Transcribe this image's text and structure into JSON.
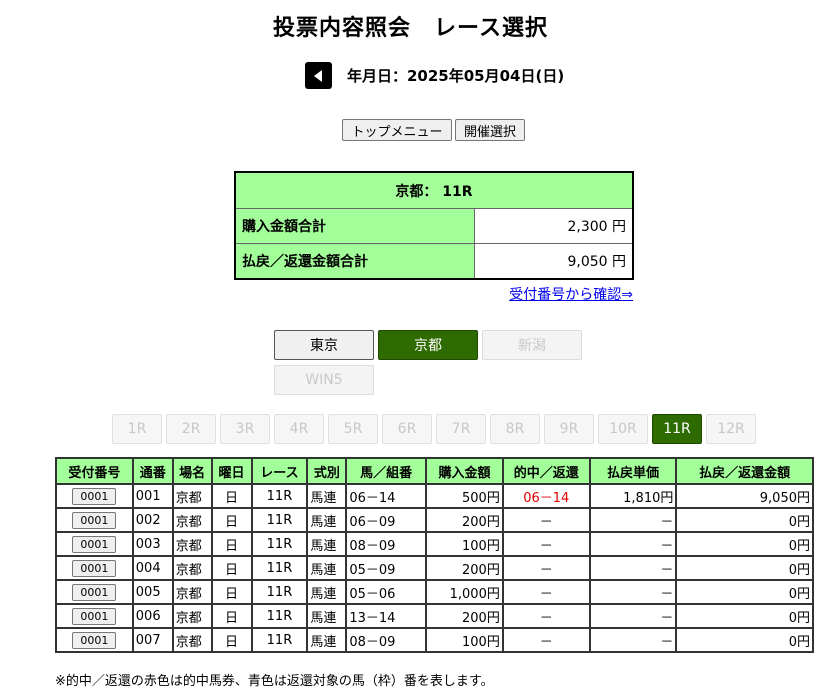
{
  "title": "投票内容照会　レース選択",
  "date_label": "年月日：2025年05月04日(日)",
  "buttons": {
    "top_menu": "トップメニュー",
    "kaisai": "開催選択"
  },
  "summary": {
    "header": "京都： 11R",
    "purchase_label": "購入金額合計",
    "purchase_value": "2,300 円",
    "refund_label": "払戻／返還金額合計",
    "refund_value": "9,050 円"
  },
  "confirm_link": "受付番号から確認⇒",
  "venues": [
    {
      "label": "東京",
      "state": "normal"
    },
    {
      "label": "京都",
      "state": "active"
    },
    {
      "label": "新潟",
      "state": "disabled"
    },
    {
      "label": "WIN5",
      "state": "disabled"
    }
  ],
  "races": [
    "1R",
    "2R",
    "3R",
    "4R",
    "5R",
    "6R",
    "7R",
    "8R",
    "9R",
    "10R",
    "11R",
    "12R"
  ],
  "active_race": "11R",
  "table": {
    "headers": [
      "受付番号",
      "通番",
      "場名",
      "曜日",
      "レース",
      "式別",
      "馬／組番",
      "購入金額",
      "的中／返還",
      "払戻単価",
      "払戻／返還金額"
    ],
    "rows": [
      [
        "0001",
        "001",
        "京都",
        "日",
        "11R",
        "馬連",
        "06－14",
        "500円",
        "06－14",
        "1,810円",
        "9,050円"
      ],
      [
        "0001",
        "002",
        "京都",
        "日",
        "11R",
        "馬連",
        "06－09",
        "200円",
        "－",
        "－",
        "0円"
      ],
      [
        "0001",
        "003",
        "京都",
        "日",
        "11R",
        "馬連",
        "08－09",
        "100円",
        "－",
        "－",
        "0円"
      ],
      [
        "0001",
        "004",
        "京都",
        "日",
        "11R",
        "馬連",
        "05－09",
        "200円",
        "－",
        "－",
        "0円"
      ],
      [
        "0001",
        "005",
        "京都",
        "日",
        "11R",
        "馬連",
        "05－06",
        "1,000円",
        "－",
        "－",
        "0円"
      ],
      [
        "0001",
        "006",
        "京都",
        "日",
        "11R",
        "馬連",
        "13－14",
        "200円",
        "－",
        "－",
        "0円"
      ],
      [
        "0001",
        "007",
        "京都",
        "日",
        "11R",
        "馬連",
        "08－09",
        "100円",
        "－",
        "－",
        "0円"
      ]
    ]
  },
  "note": "※的中／返還の赤色は的中馬券、青色は返還対象の馬（枠）番を表します。",
  "colors": {
    "header_green": "#a3ff99",
    "active_green": "#2e6b00",
    "hit_red": "#e00000",
    "link_blue": "#0000ee"
  }
}
